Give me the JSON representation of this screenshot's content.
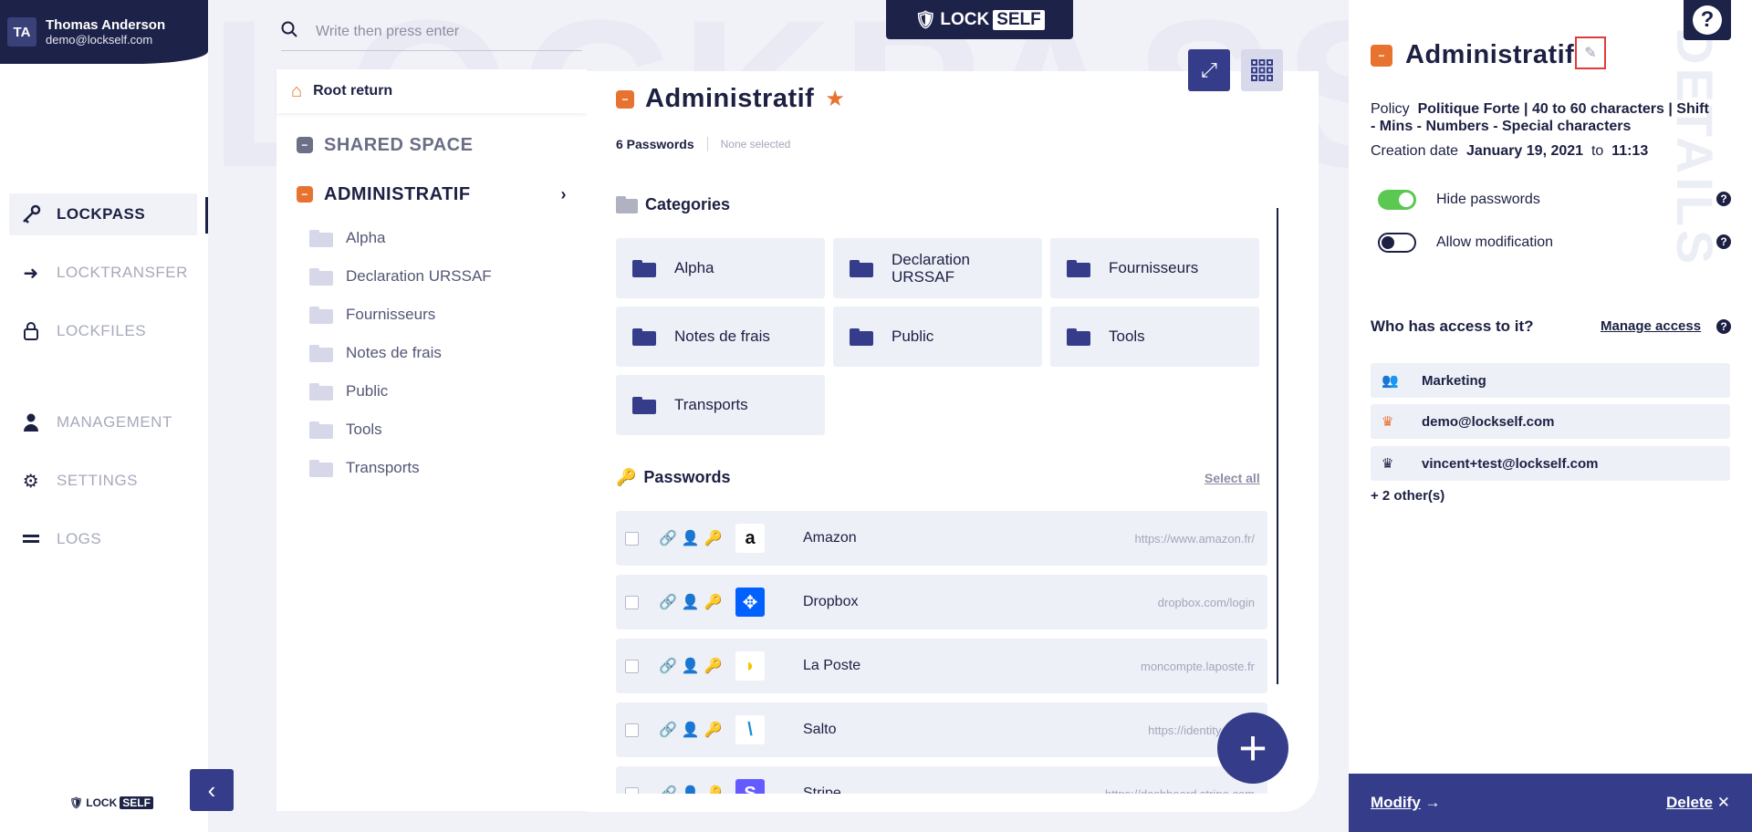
{
  "watermark": "LOCKPASS",
  "details_watermark": "DETAILS",
  "user": {
    "initials": "TA",
    "name": "Thomas Anderson",
    "email": "demo@lockself.com"
  },
  "nav": [
    {
      "label": "LOCKPASS",
      "icon": "lockpass-key-icon",
      "active": true
    },
    {
      "label": "LOCKTRANSFER",
      "icon": "arrow-right-icon",
      "active": false
    },
    {
      "label": "LOCKFILES",
      "icon": "padlock-icon",
      "active": false
    },
    {
      "label": "MANAGEMENT",
      "icon": "user-icon",
      "active": false
    },
    {
      "label": "SETTINGS",
      "icon": "gears-icon",
      "active": false
    },
    {
      "label": "LOGS",
      "icon": "logs-icon",
      "active": false
    }
  ],
  "brand": {
    "lock": "LOCK",
    "self": "SELF"
  },
  "search": {
    "placeholder": "Write then press enter"
  },
  "tree": {
    "root_label": "Root return",
    "shared_space": "SHARED SPACE",
    "current": "ADMINISTRATIF",
    "folders": [
      "Alpha",
      "Declaration URSSAF",
      "Fournisseurs",
      "Notes de frais",
      "Public",
      "Tools",
      "Transports"
    ]
  },
  "main": {
    "title": "Administratif",
    "passwords_count": "6 Passwords",
    "selection": "None selected",
    "categories_title": "Categories",
    "categories": [
      "Alpha",
      "Declaration URSSAF",
      "Fournisseurs",
      "Notes de frais",
      "Public",
      "Tools",
      "Transports"
    ],
    "passwords_title": "Passwords",
    "select_all": "Select all",
    "passwords": [
      {
        "name": "Amazon",
        "url": "https://www.amazon.fr/",
        "logo": "a",
        "logo_bg": "#ffffff",
        "logo_fg": "#111111"
      },
      {
        "name": "Dropbox",
        "url": "dropbox.com/login",
        "logo": "✥",
        "logo_bg": "#0061fe",
        "logo_fg": "#ffffff"
      },
      {
        "name": "La Poste",
        "url": "moncompte.laposte.fr",
        "logo": "◗",
        "logo_bg": "#ffffff",
        "logo_fg": "#f2c700"
      },
      {
        "name": "Salto",
        "url": "https://identity.saltok",
        "logo": "\\",
        "logo_bg": "#ffffff",
        "logo_fg": "#1a8fd6"
      },
      {
        "name": "Stripe",
        "url": "https://dashboard.stripe.com",
        "logo": "S",
        "logo_bg": "#635bff",
        "logo_fg": "#ffffff"
      }
    ],
    "fab_label": "+"
  },
  "details": {
    "title": "Administratif",
    "policy_label": "Policy",
    "policy_value": "Politique Forte | 40 to 60 characters | Shift - Mins - Numbers - Special characters",
    "creation_label": "Creation date",
    "creation_date": "January 19, 2021",
    "to_label": "to",
    "creation_time": "11:13",
    "hide_passwords": {
      "label": "Hide passwords",
      "on": true
    },
    "allow_modification": {
      "label": "Allow modification",
      "on": false
    },
    "access_title": "Who has access to it?",
    "manage_access": "Manage access",
    "access": [
      {
        "label": "Marketing",
        "icon": "group-icon"
      },
      {
        "label": "demo@lockself.com",
        "icon": "crown-orange-icon"
      },
      {
        "label": "vincent+test@lockself.com",
        "icon": "crown-dark-icon"
      }
    ],
    "others": "+ 2 other(s)",
    "modify": "Modify",
    "delete": "Delete"
  },
  "colors": {
    "navy": "#1c2248",
    "primary": "#353d8a",
    "accent": "#e8722f",
    "toggle_on": "#5bc851"
  }
}
